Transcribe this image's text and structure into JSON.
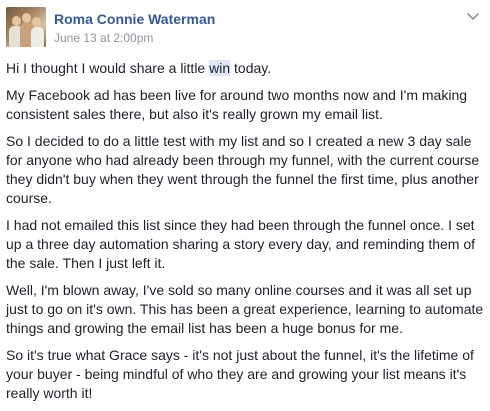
{
  "post": {
    "author": "Roma Connie Waterman",
    "timestamp": "June 13 at 2:00pm",
    "intro_before": "Hi I thought I would share a little ",
    "intro_highlight": "win",
    "intro_after": " today.",
    "paragraphs": [
      "My Facebook ad has been live for around two months now and I'm making consistent sales there, but also it's really grown my email list.",
      "So I decided to do a little test with my list and so I created a new 3 day sale for anyone who had already been through my funnel, with the current course they didn't buy when they went through the funnel the first time, plus another course.",
      "I had not emailed this list since they had been through the funnel once. I set up a three day automation sharing a story every day, and reminding them of the sale. Then I just left it.",
      "Well, I'm blown away, I've sold so many online courses and it was all set up just to go on it's own. This has been a great experience, learning to automate things and growing the email list has been a huge bonus for me.",
      "So it's true what Grace says - it's not just about the funnel, it's the lifetime of your buyer - being mindful of who they are and growing your list means it's really worth it!"
    ]
  },
  "icons": {
    "avatar": "profile-photo",
    "options": "chevron-down-icon"
  },
  "colors": {
    "author": "#365899",
    "timestamp": "#90949c",
    "text": "#1d2129",
    "highlight": "#dfe6f5"
  }
}
